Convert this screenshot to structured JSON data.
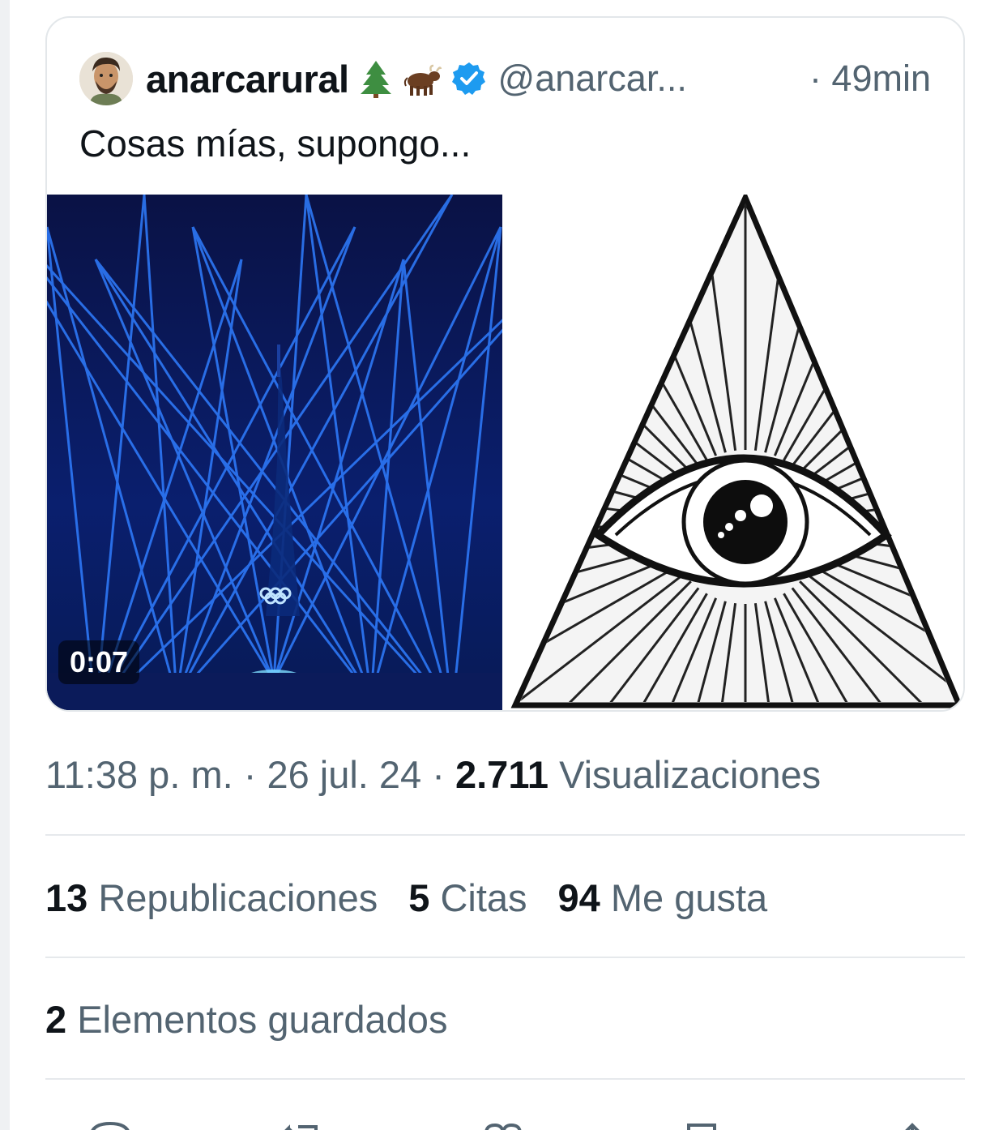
{
  "quoted_tweet": {
    "display_name": "anarcarural",
    "name_emojis": [
      "evergreen-tree-icon",
      "ox-icon"
    ],
    "verified": true,
    "handle": "@anarcar...",
    "time": "· 49min",
    "text": "Cosas mías, supongo...",
    "media": {
      "video_duration": "0:07",
      "left_image": "blue-laser-light-show-photo",
      "right_image": "all-seeing-eye-pyramid-drawing"
    }
  },
  "meta": {
    "time": "11:38 p. m.",
    "sep1": " · ",
    "date": "26 jul. 24",
    "sep2": " · ",
    "views_count": "2.711",
    "views_label": "Visualizaciones"
  },
  "stats": {
    "reposts_count": "13",
    "reposts_label": "Republicaciones",
    "quotes_count": "5",
    "quotes_label": "Citas",
    "likes_count": "94",
    "likes_label": "Me gusta"
  },
  "bookmarks": {
    "count": "2",
    "label": "Elementos guardados"
  },
  "colors": {
    "text_primary": "#0f1419",
    "text_secondary": "#536471",
    "verified_blue": "#1d9bf0",
    "border": "#e3e7ea"
  },
  "action_icons": [
    "reply-icon",
    "repost-icon",
    "like-icon",
    "bookmark-icon",
    "share-icon"
  ]
}
